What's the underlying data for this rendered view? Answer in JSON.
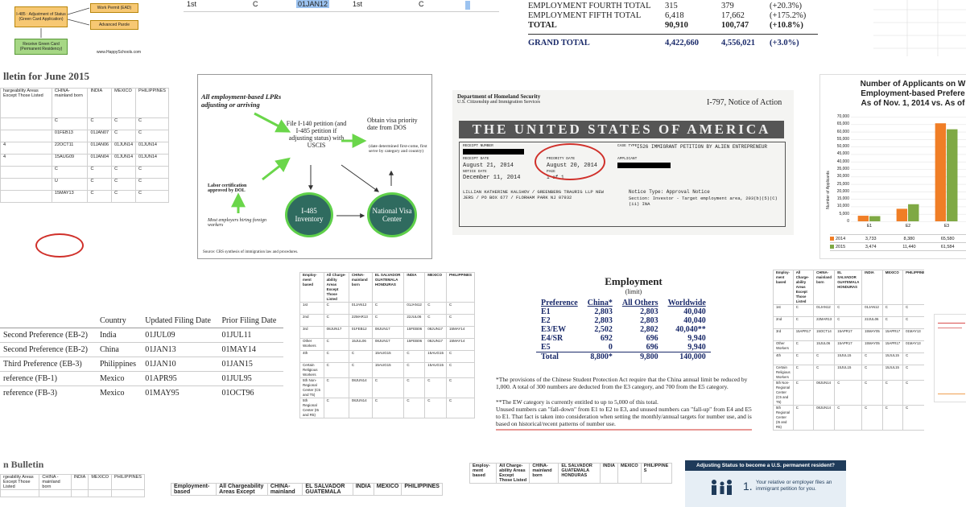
{
  "flowchart_top": {
    "node1": "I-485 : Adjustment of Status (Green Card Application)",
    "node2": "Work Permit (EAD)",
    "node3": "Advanced Parole",
    "node4": "Receive Green Card (Permanent Residency)",
    "source": "www.HappySchools.com"
  },
  "top_strip": {
    "row_label": "1st",
    "cell_c": "C",
    "cell_date": "01JAN12",
    "row_label2": "1st",
    "cell_c2": "C"
  },
  "top_totals": {
    "rows": [
      {
        "label": "EMPLOYMENT FOURTH TOTAL",
        "a": "315",
        "b": "379",
        "c": "(+20.3%)"
      },
      {
        "label": "EMPLOYMENT FIFTH TOTAL",
        "a": "6,418",
        "b": "17,662",
        "c": "(+175.2%)"
      },
      {
        "label": "TOTAL",
        "a": "90,910",
        "b": "100,747",
        "c": "(+10.8%)"
      }
    ],
    "grand_label": "GRAND TOTAL",
    "grand_a": "4,422,660",
    "grand_b": "4,556,021",
    "grand_c": "(+3.0%)"
  },
  "bulletin_june": {
    "title": "lletin for June 2015",
    "headers": [
      "hargeability Areas Except Those Listed",
      "CHINA- mainland born",
      "INDIA",
      "MEXICO",
      "PHILIPPINES"
    ],
    "rows": [
      [
        "",
        "C",
        "C",
        "C",
        "C"
      ],
      [
        "",
        "01FEB13",
        "01JAN07",
        "C",
        "C"
      ],
      [
        "4",
        "22OCT11",
        "01JAN06",
        "01JUN14",
        "01JUN14"
      ],
      [
        "4",
        "15AUG09",
        "01JAN04",
        "01JUN14",
        "01JUN14"
      ],
      [
        "",
        "C",
        "C",
        "C",
        "C"
      ],
      [
        "",
        "U",
        "C",
        "C",
        "C"
      ],
      [
        "",
        "15MAY13",
        "C",
        "C",
        "C"
      ]
    ]
  },
  "diagram": {
    "lead": "All employment-based LPRs adjusting or arriving",
    "file_step": "File I-140 petition (and I-485 petition if adjusting status) with USCIS",
    "visa_step": "Obtain visa priority date from DOS",
    "visa_note": "(date determined first-come, first serve by category and country)",
    "labor": "Labor certification approved by DOL",
    "labor_note": "Most employers hiring foreign workers",
    "circle_left": "I-485 Inventory",
    "circle_right": "National Visa Center",
    "source": "Source: CRS synthesis of immigration law and procedures."
  },
  "notice": {
    "agency": "Department of Homeland Security",
    "agency2": "U.S. Citizenship and Immigration Services",
    "title": "I-797, Notice of Action",
    "banner": "THE UNITED STATES OF AMERICA",
    "receipt_label": "RECEIPT NUMBER",
    "case_type_label": "CASE TYPE",
    "case_type": "I526 IMMIGRANT PETITION BY ALIEN ENTREPRENEUR",
    "received_label": "RECEIPT DATE",
    "received": "August 21, 2014",
    "priority_label": "PRIORITY DATE",
    "priority": "August 20, 2014",
    "applicant_label": "APPLICANT",
    "notice_label": "NOTICE DATE",
    "notice_date": "December 11, 2014",
    "page_label": "PAGE",
    "page": "1 of 1",
    "address": "LILLIAN KATHERINE KALSHOV / GREENBERG TRAURIG LLP NEW JERS / PO BOX 677 / FLORHAM PARK NJ 07932",
    "notice_type": "Notice Type: Approval Notice",
    "section": "Section: Investor - Target employment area, 203(b)(5)(C)(ii) INA"
  },
  "chart": {
    "title_line1": "Number of Applicants on W",
    "title_line2": "Employment-based Prefere",
    "title_line3": "As of Nov. 1, 2014 vs. As of",
    "ylabel": "Number of Applicants",
    "legend_2014": "2014",
    "legend_2015": "2015",
    "yticks": [
      "70,000",
      "65,000",
      "60,000",
      "55,000",
      "50,000",
      "45,000",
      "40,000",
      "35,000",
      "30,000",
      "25,000",
      "20,000",
      "15,000",
      "10,000",
      "5,000",
      "0"
    ],
    "colors": {
      "y2014": "#f07e26",
      "y2015": "#7fa944"
    }
  },
  "chart_data": {
    "type": "bar",
    "categories": [
      "E1",
      "E2",
      "E3"
    ],
    "series": [
      {
        "name": "2014",
        "values": [
          3733,
          8380,
          65580
        ]
      },
      {
        "name": "2015",
        "values": [
          3474,
          11440,
          61584
        ]
      }
    ],
    "title": "Number of Applicants on W Employment-based Prefere As of Nov. 1, 2014 vs. As of",
    "ylabel": "Number of Applicants",
    "ylim": [
      0,
      70000
    ]
  },
  "filing_table": {
    "headers": [
      "",
      "Country",
      "Updated Filing Date",
      "Prior Filing Date"
    ],
    "rows": [
      [
        "Second Preference (EB-2)",
        "India",
        "01JUL09",
        "01JUL11"
      ],
      [
        "Second Preference (EB-2)",
        "China",
        "01JAN13",
        "01MAY14"
      ],
      [
        "Third Preference (EB-3)",
        "Philippines",
        "01JAN10",
        "01JAN15"
      ],
      [
        "reference (FB-1)",
        "Mexico",
        "01APR95",
        "01JUL95"
      ],
      [
        "reference (FB-3)",
        "Mexico",
        "01MAY95",
        "01OCT96"
      ]
    ]
  },
  "mid_bulletin": {
    "headers": [
      "Employ- ment based",
      "All Charge- ability Areas Except Those Listed",
      "CHINA- mainland born",
      "EL SALVADOR GUATEMALA HONDURAS",
      "INDIA",
      "MEXICO",
      "PHILIPPINES"
    ],
    "rows": [
      [
        "1st",
        "C",
        "01JAN12",
        "C",
        "01JAN12",
        "C",
        "C"
      ],
      [
        "2nd",
        "C",
        "22MAR13",
        "C",
        "22JUL06",
        "C",
        "C"
      ],
      [
        "3rd",
        "08JUN17",
        "01FEB12",
        "08JUN17",
        "15FEB06",
        "08JUN17",
        "15MAY14"
      ],
      [
        "Other Workers",
        "C",
        "15JUL06",
        "08JUN17",
        "15FEB06",
        "08JUN17",
        "15MAY14"
      ],
      [
        "4th",
        "C",
        "C",
        "15AUG15",
        "C",
        "15AUG15",
        "C"
      ],
      [
        "Certain Religious Workers",
        "C",
        "C",
        "15AUG15",
        "C",
        "15AUG15",
        "C"
      ],
      [
        "5th Non- Regional Center (C5 and T5)",
        "C",
        "08JUN14",
        "C",
        "C",
        "C",
        "C"
      ],
      [
        "5th Regional Center (I5 and R5)",
        "C",
        "08JUN14",
        "C",
        "C",
        "C",
        "C"
      ]
    ]
  },
  "employment_limit": {
    "title": "Employment",
    "subtitle": "(limit)",
    "headers": [
      "Preference",
      "China*",
      "All Others",
      "Worldwide"
    ],
    "rows": [
      [
        "E1",
        "2,803",
        "2,803",
        "40,040"
      ],
      [
        "E2",
        "2,803",
        "2,803",
        "40,040"
      ],
      [
        "E3/EW",
        "2,502",
        "2,802",
        "40,040**"
      ],
      [
        "E4/SR",
        "692",
        "696",
        "9,940"
      ],
      [
        "E5",
        "0",
        "696",
        "9,940"
      ]
    ],
    "total": [
      "Total",
      "8,800*",
      "9,800",
      "140,000"
    ],
    "note1": "*The provisions of the Chinese Student Protection Act require that the China annual limit be reduced by 1,000. A total of 300 numbers are deducted from the E3 category, and 700 from the E5 category.",
    "note2": "**The EW category is currently entitled to up to 5,000 of this total.",
    "note3": "Unused numbers can \"fall-down\" from E1 to E2 to E3, and unused numbers can \"fall-up\" from E4 and E5 to E1. That fact is taken into consideration when setting the monthly/annual targets for number use, and is based on historical/recent patterns of number use."
  },
  "right_bulletin": {
    "headers": [
      "Employ- ment based",
      "All Charge- ability Areas Except Those Listed",
      "CHINA- mainland born",
      "EL SALVADOR GUATEMALA HONDURAS",
      "INDIA",
      "MEXICO",
      "PHILIPPINES"
    ],
    "rows": [
      [
        "1st",
        "C",
        "01JAN12",
        "C",
        "01JAN12",
        "C",
        "C"
      ],
      [
        "2nd",
        "C",
        "22MAR13",
        "C",
        "22JUL06",
        "C",
        "C"
      ],
      [
        "3rd",
        "15APR17",
        "15OCT14",
        "15APR17",
        "15MAY05",
        "15APR17",
        "01MAY13"
      ],
      [
        "Other Workers",
        "C",
        "15JUL06",
        "15APR17",
        "15MAY05",
        "15APR17",
        "01MAY13"
      ],
      [
        "4th",
        "C",
        "C",
        "15JUL15",
        "C",
        "15JUL15",
        "C"
      ],
      [
        "Certain Religious Workers",
        "C",
        "C",
        "15JUL15",
        "C",
        "15JUL15",
        "C"
      ],
      [
        "5th Non- Regional Center (C5 and T5)",
        "C",
        "08JUN14",
        "C",
        "C",
        "C",
        "C"
      ],
      [
        "5th Regional Center (I5 and R5)",
        "C",
        "08JUN14",
        "C",
        "C",
        "C",
        "C"
      ]
    ]
  },
  "bottom_left": {
    "title": "n Bulletin",
    "headers": [
      "rgeability Areas Except Those Listed",
      "CHINA - mainland born",
      "INDIA",
      "MEXICO",
      "PHILIPPINES"
    ]
  },
  "bottom_mid": {
    "headers": [
      "Employment- based",
      "All Chargeability Areas Except",
      "CHINA- mainland",
      "EL SALVADOR GUATEMALA",
      "INDIA",
      "MEXICO",
      "PHILIPPINES"
    ]
  },
  "bottom_mid2": {
    "headers": [
      "Employ- ment based",
      "All Charge- ability Areas Except Those Listed",
      "CHINA- mainland born",
      "EL SALVADOR GUATEMALA HONDURAS",
      "INDIA",
      "MEXICO",
      "PHILIPPINE S"
    ]
  },
  "adjusting_card": {
    "title": "Adjusting Status to become a U.S. permanent resident?",
    "step_num": "1.",
    "step_text": "Your relative or employer files an immigrant petition for you."
  }
}
